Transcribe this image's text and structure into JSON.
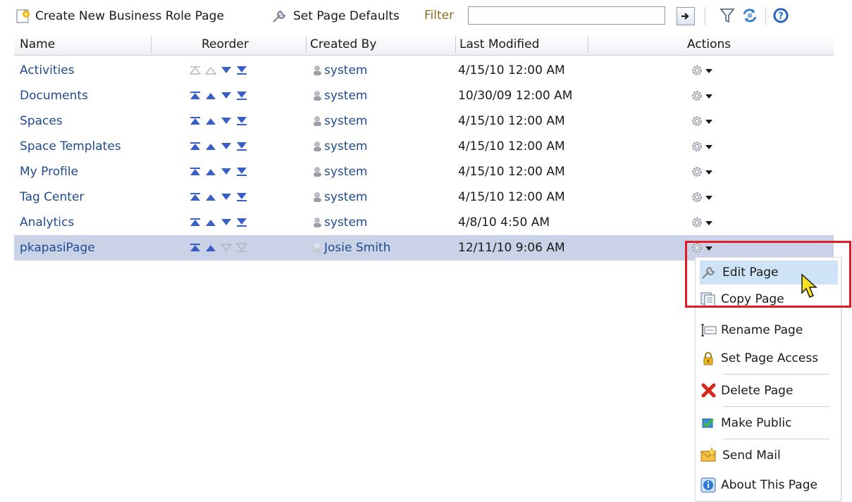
{
  "toolbar": {
    "create_label": "Create New Business Role Page",
    "defaults_label": "Set Page Defaults",
    "filter_label": "Filter",
    "filter_value": "",
    "go_icon": "arrow-right-icon",
    "filter_icon": "funnel-icon",
    "refresh_icon": "refresh-icon",
    "help_icon": "help-icon"
  },
  "columns": {
    "name": "Name",
    "reorder": "Reorder",
    "created_by": "Created By",
    "last_modified": "Last Modified",
    "actions": "Actions"
  },
  "rows": [
    {
      "name": "Activities",
      "created_by": "system",
      "modified": "4/15/10 12:00 AM"
    },
    {
      "name": "Documents",
      "created_by": "system",
      "modified": "10/30/09 12:00 AM"
    },
    {
      "name": "Spaces",
      "created_by": "system",
      "modified": "4/15/10 12:00 AM"
    },
    {
      "name": "Space Templates",
      "created_by": "system",
      "modified": "4/15/10 12:00 AM"
    },
    {
      "name": "My Profile",
      "created_by": "system",
      "modified": "4/15/10 12:00 AM"
    },
    {
      "name": "Tag Center",
      "created_by": "system",
      "modified": "4/15/10 12:00 AM"
    },
    {
      "name": "Analytics",
      "created_by": "system",
      "modified": "4/8/10 4:50 AM"
    },
    {
      "name": "pkapasiPage",
      "created_by": "Josie Smith",
      "modified": "12/11/10 9:06 AM"
    }
  ],
  "menu": {
    "items": [
      {
        "label": "Edit Page",
        "icon": "wrench-icon"
      },
      {
        "label": "Copy Page",
        "icon": "copy-icon"
      },
      {
        "label": "Rename Page",
        "icon": "rename-icon"
      },
      {
        "label": "Set Page Access",
        "icon": "lock-icon"
      },
      {
        "label": "Delete Page",
        "icon": "delete-icon"
      },
      {
        "label": "Make Public",
        "icon": "checkbox-icon"
      },
      {
        "label": "Send Mail",
        "icon": "mail-icon"
      },
      {
        "label": "About This Page",
        "icon": "info-icon"
      }
    ]
  },
  "colors": {
    "link": "#1e4b8f",
    "selected_row": "#c9d2e6",
    "menu_hover": "#cfe3f6",
    "callout": "#e01b24"
  }
}
